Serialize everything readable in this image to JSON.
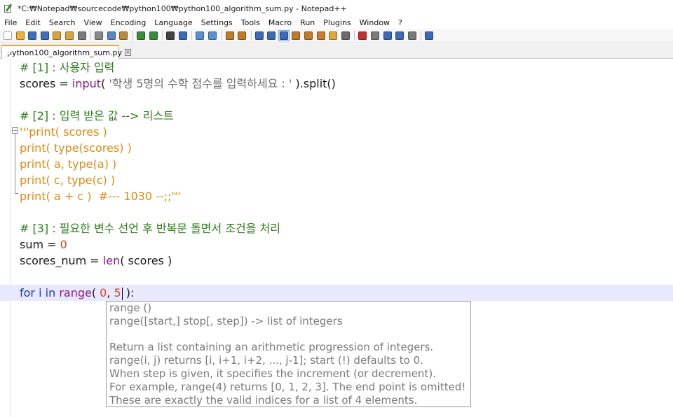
{
  "window": {
    "title": "*C:₩Notepad₩sourcecode₩python100₩python100_algorithm_sum.py - Notepad++"
  },
  "menu": [
    "File",
    "Edit",
    "Search",
    "View",
    "Encoding",
    "Language",
    "Settings",
    "Tools",
    "Macro",
    "Run",
    "Plugins",
    "Window",
    "?"
  ],
  "toolbar": {
    "icons": [
      {
        "name": "new-file-icon",
        "color": "#ffffff"
      },
      {
        "name": "open-file-icon",
        "color": "#e9b23a"
      },
      {
        "name": "save-icon",
        "color": "#3f6fb8"
      },
      {
        "name": "save-all-icon",
        "color": "#3f6fb8"
      },
      {
        "name": "close-icon",
        "color": "#d9a23c"
      },
      {
        "name": "close-all-icon",
        "color": "#d9a23c"
      },
      {
        "name": "print-icon",
        "color": "#7a7a7a"
      },
      {
        "name": "sep"
      },
      {
        "name": "cut-icon",
        "color": "#8a8a8a"
      },
      {
        "name": "copy-icon",
        "color": "#5c86c4"
      },
      {
        "name": "paste-icon",
        "color": "#b98a3a"
      },
      {
        "name": "sep"
      },
      {
        "name": "undo-icon",
        "color": "#3d8a3d"
      },
      {
        "name": "redo-icon",
        "color": "#3d8a3d"
      },
      {
        "name": "sep"
      },
      {
        "name": "find-icon",
        "color": "#444444"
      },
      {
        "name": "replace-icon",
        "color": "#3a6ab8"
      },
      {
        "name": "sep"
      },
      {
        "name": "zoom-in-icon",
        "color": "#5b8fd0"
      },
      {
        "name": "zoom-out-icon",
        "color": "#5b8fd0"
      },
      {
        "name": "sep"
      },
      {
        "name": "sync-vertical-icon",
        "color": "#c07a2a"
      },
      {
        "name": "sync-horizontal-icon",
        "color": "#c07a2a"
      },
      {
        "name": "sep"
      },
      {
        "name": "word-wrap-icon",
        "color": "#3a6ab8"
      },
      {
        "name": "show-all-chars-icon",
        "color": "#3a6ab8"
      },
      {
        "name": "indent-guide-icon",
        "color": "#3a6ab8",
        "active": true
      },
      {
        "name": "lang-define-icon",
        "color": "#c07a2a"
      },
      {
        "name": "doc-map-icon",
        "color": "#c07a2a"
      },
      {
        "name": "function-list-icon",
        "color": "#d07a2a"
      },
      {
        "name": "folder-workspace-icon",
        "color": "#e0a83a"
      },
      {
        "name": "monitoring-icon",
        "color": "#6a6a6a"
      },
      {
        "name": "sep"
      },
      {
        "name": "record-macro-icon",
        "color": "#c03030"
      },
      {
        "name": "stop-macro-icon",
        "color": "#7a7a7a"
      },
      {
        "name": "play-macro-icon",
        "color": "#3a6ab8"
      },
      {
        "name": "run-macro-multiple-icon",
        "color": "#3a6ab8"
      },
      {
        "name": "save-macro-icon",
        "color": "#7a7a7a"
      },
      {
        "name": "sep"
      },
      {
        "name": "run-icon",
        "color": "#3a6ab8"
      }
    ]
  },
  "tab": {
    "label": "python100_algorithm_sum.py",
    "close": "×",
    "accent": "#f7a13a"
  },
  "code": {
    "l1_comment": "# [1] : 사용자 입력",
    "l2_var": "scores = ",
    "l2_fn": "input",
    "l2_open": "( ",
    "l2_str": "'학생 5명의 수학 점수를 입력하세요 : '",
    "l2_close": " ).split()",
    "l3": "",
    "l4_comment": "# [2] : 입력 받은 값 --> 리스트",
    "l5_doc": "'''print( scores )",
    "l6_doc": "print( type(scores) )",
    "l7_doc": "print( a, type(a) )",
    "l8_doc": "print( c, type(c) )",
    "l9_doc": "print( a + c )  #--- 1030 --;;'''",
    "l10": "",
    "l11_comment": "# [3] : 필요한 변수 선언 후 반복문 돌면서 조건을 처리",
    "l12_var": "sum = ",
    "l12_num": "0",
    "l13_var": "scores_num = ",
    "l13_fn": "len",
    "l13_rest": "( scores )",
    "l14": "",
    "l15_for": "for",
    "l15_i": " i ",
    "l15_in": "in",
    "l15_sp": " ",
    "l15_range": "range",
    "l15_open": "( ",
    "l15_n0": "0",
    "l15_comma": ", ",
    "l15_n5": "5",
    "l15_close": " ):"
  },
  "calltip": {
    "line1": "range ()",
    "line2": "range([start,] stop[, step]) -> list of integers",
    "line3": "Return a list containing an arithmetic progression of integers.",
    "line4": "range(i, j) returns [i, i+1, i+2, ..., j-1]; start (!) defaults to 0.",
    "line5": "When step is given, it specifies the increment (or decrement).",
    "line6": "For example, range(4) returns [0, 1, 2, 3].  The end point is omitted!",
    "line7": "These are exactly the valid indices for a list of 4 elements."
  }
}
